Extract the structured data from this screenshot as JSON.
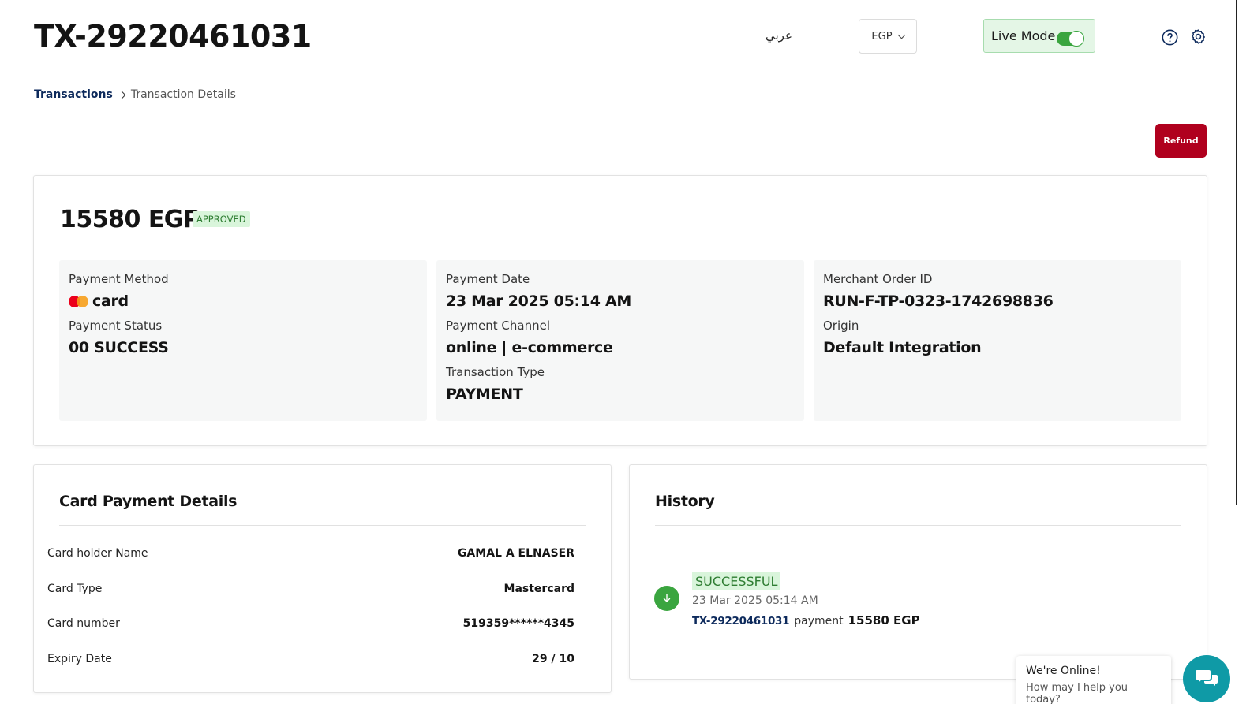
{
  "header": {
    "title": "TX-29220461031",
    "language_link": "عربي",
    "currency": "EGP",
    "live_mode_label": "Live Mode",
    "live_mode_on": true
  },
  "breadcrumb": {
    "parent": "Transactions",
    "current": "Transaction Details"
  },
  "actions": {
    "refund_label": "Refund"
  },
  "summary": {
    "amount": "15580 EGP",
    "status": "APPROVED",
    "columns": [
      {
        "fields": [
          {
            "label": "Payment Method",
            "value": "card",
            "icon": "mastercard-logo-icon"
          },
          {
            "label": "Payment Status",
            "value": "00 SUCCESS"
          }
        ]
      },
      {
        "fields": [
          {
            "label": "Payment Date",
            "value": "23 Mar 2025 05:14 AM"
          },
          {
            "label": "Payment Channel",
            "value": "online | e-commerce"
          },
          {
            "label": "Transaction Type",
            "value": "PAYMENT"
          }
        ]
      },
      {
        "fields": [
          {
            "label": "Merchant Order ID",
            "value": "RUN-F-TP-0323-1742698836"
          },
          {
            "label": "Origin",
            "value": "Default Integration"
          }
        ]
      }
    ]
  },
  "card_details": {
    "title": "Card Payment Details",
    "rows": [
      {
        "label": "Card holder Name",
        "value": "GAMAL A ELNASER"
      },
      {
        "label": "Card Type",
        "value": "Mastercard"
      },
      {
        "label": "Card number",
        "value": "519359******4345"
      },
      {
        "label": "Expiry Date",
        "value": "29 / 10"
      }
    ]
  },
  "history": {
    "title": "History",
    "entries": [
      {
        "status": "SUCCESSFUL",
        "date": "23 Mar 2025 05:14 AM",
        "tx_id": "TX-29220461031",
        "type": "payment",
        "amount": "15580 EGP",
        "icon": "arrow-down-icon"
      }
    ]
  },
  "chat": {
    "title": "We're Online!",
    "subtitle": "How may I help you today?"
  },
  "colors": {
    "accent_navy": "#0d2a5c",
    "refund_red": "#b0001e",
    "success_green": "#3aa53f",
    "success_bg": "#d9f5db",
    "chat_teal": "#0f9aa6"
  }
}
